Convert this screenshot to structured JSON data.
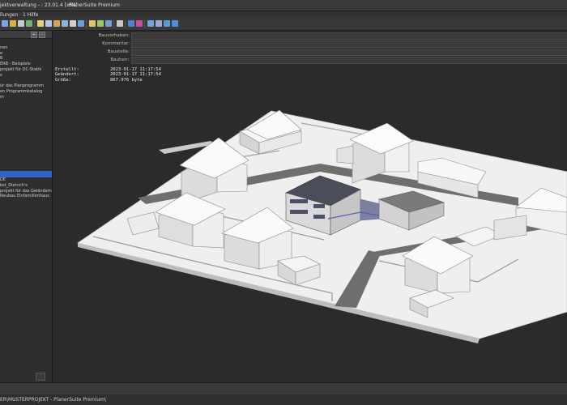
{
  "titlebar": {
    "left": "jektverwaltung - : 23.01.4 [x64]",
    "right": "PlanerSuite Premium"
  },
  "menubar": {
    "label": "llungen · 1 Hilfe"
  },
  "tree": {
    "items": [
      "",
      "nen",
      "e",
      "B",
      "ERB - Beispiele",
      "projekt für DC-Statik",
      "s",
      "",
      "ür das Planprogramm",
      "en Programmkatalog",
      "m",
      "",
      "",
      "",
      "",
      "",
      "",
      "",
      "",
      "",
      "",
      "",
      "",
      "",
      "",
      "DE",
      "bst_Dietrich's",
      "projekt für das Geländemo",
      "Neubau Einfamilienhaus"
    ],
    "selected_index": 24
  },
  "properties": {
    "fields": [
      {
        "label": "Bauvorhaben:",
        "value": ""
      },
      {
        "label": "Kommentar:",
        "value": ""
      },
      {
        "label": "Baustelle:",
        "value": ""
      },
      {
        "label": "Bauherr:",
        "value": ""
      }
    ]
  },
  "info": [
    {
      "key": "Erstellt:",
      "value": "2023-01-17 11:17:54"
    },
    {
      "key": "Geändert:",
      "value": "2023-01-17 11:17:54"
    },
    {
      "key": "Größe:",
      "value": "867.976 byte"
    }
  ],
  "statusbar": {
    "path": "ER\\MUSTERPROJEKT - PlanerSuite Premium\\"
  },
  "colors": {
    "accent": "#2f64c8",
    "background": "#2b2b2b",
    "road": "#6e6e6e",
    "ground": "#ececec"
  }
}
